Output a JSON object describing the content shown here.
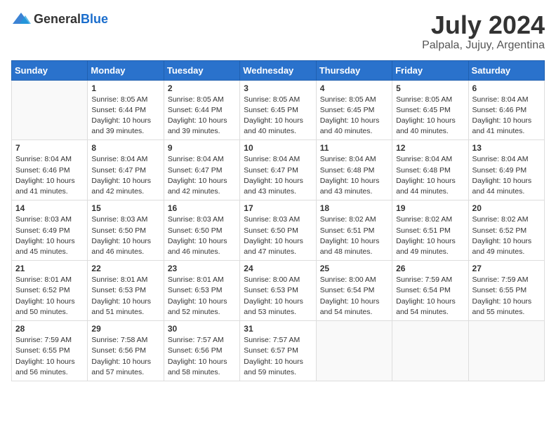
{
  "header": {
    "logo_general": "General",
    "logo_blue": "Blue",
    "month_year": "July 2024",
    "location": "Palpala, Jujuy, Argentina"
  },
  "weekdays": [
    "Sunday",
    "Monday",
    "Tuesday",
    "Wednesday",
    "Thursday",
    "Friday",
    "Saturday"
  ],
  "weeks": [
    [
      {
        "day": "",
        "sunrise": "",
        "sunset": "",
        "daylight": ""
      },
      {
        "day": "1",
        "sunrise": "Sunrise: 8:05 AM",
        "sunset": "Sunset: 6:44 PM",
        "daylight": "Daylight: 10 hours and 39 minutes."
      },
      {
        "day": "2",
        "sunrise": "Sunrise: 8:05 AM",
        "sunset": "Sunset: 6:44 PM",
        "daylight": "Daylight: 10 hours and 39 minutes."
      },
      {
        "day": "3",
        "sunrise": "Sunrise: 8:05 AM",
        "sunset": "Sunset: 6:45 PM",
        "daylight": "Daylight: 10 hours and 40 minutes."
      },
      {
        "day": "4",
        "sunrise": "Sunrise: 8:05 AM",
        "sunset": "Sunset: 6:45 PM",
        "daylight": "Daylight: 10 hours and 40 minutes."
      },
      {
        "day": "5",
        "sunrise": "Sunrise: 8:05 AM",
        "sunset": "Sunset: 6:45 PM",
        "daylight": "Daylight: 10 hours and 40 minutes."
      },
      {
        "day": "6",
        "sunrise": "Sunrise: 8:04 AM",
        "sunset": "Sunset: 6:46 PM",
        "daylight": "Daylight: 10 hours and 41 minutes."
      }
    ],
    [
      {
        "day": "7",
        "sunrise": "Sunrise: 8:04 AM",
        "sunset": "Sunset: 6:46 PM",
        "daylight": "Daylight: 10 hours and 41 minutes."
      },
      {
        "day": "8",
        "sunrise": "Sunrise: 8:04 AM",
        "sunset": "Sunset: 6:47 PM",
        "daylight": "Daylight: 10 hours and 42 minutes."
      },
      {
        "day": "9",
        "sunrise": "Sunrise: 8:04 AM",
        "sunset": "Sunset: 6:47 PM",
        "daylight": "Daylight: 10 hours and 42 minutes."
      },
      {
        "day": "10",
        "sunrise": "Sunrise: 8:04 AM",
        "sunset": "Sunset: 6:47 PM",
        "daylight": "Daylight: 10 hours and 43 minutes."
      },
      {
        "day": "11",
        "sunrise": "Sunrise: 8:04 AM",
        "sunset": "Sunset: 6:48 PM",
        "daylight": "Daylight: 10 hours and 43 minutes."
      },
      {
        "day": "12",
        "sunrise": "Sunrise: 8:04 AM",
        "sunset": "Sunset: 6:48 PM",
        "daylight": "Daylight: 10 hours and 44 minutes."
      },
      {
        "day": "13",
        "sunrise": "Sunrise: 8:04 AM",
        "sunset": "Sunset: 6:49 PM",
        "daylight": "Daylight: 10 hours and 44 minutes."
      }
    ],
    [
      {
        "day": "14",
        "sunrise": "Sunrise: 8:03 AM",
        "sunset": "Sunset: 6:49 PM",
        "daylight": "Daylight: 10 hours and 45 minutes."
      },
      {
        "day": "15",
        "sunrise": "Sunrise: 8:03 AM",
        "sunset": "Sunset: 6:50 PM",
        "daylight": "Daylight: 10 hours and 46 minutes."
      },
      {
        "day": "16",
        "sunrise": "Sunrise: 8:03 AM",
        "sunset": "Sunset: 6:50 PM",
        "daylight": "Daylight: 10 hours and 46 minutes."
      },
      {
        "day": "17",
        "sunrise": "Sunrise: 8:03 AM",
        "sunset": "Sunset: 6:50 PM",
        "daylight": "Daylight: 10 hours and 47 minutes."
      },
      {
        "day": "18",
        "sunrise": "Sunrise: 8:02 AM",
        "sunset": "Sunset: 6:51 PM",
        "daylight": "Daylight: 10 hours and 48 minutes."
      },
      {
        "day": "19",
        "sunrise": "Sunrise: 8:02 AM",
        "sunset": "Sunset: 6:51 PM",
        "daylight": "Daylight: 10 hours and 49 minutes."
      },
      {
        "day": "20",
        "sunrise": "Sunrise: 8:02 AM",
        "sunset": "Sunset: 6:52 PM",
        "daylight": "Daylight: 10 hours and 49 minutes."
      }
    ],
    [
      {
        "day": "21",
        "sunrise": "Sunrise: 8:01 AM",
        "sunset": "Sunset: 6:52 PM",
        "daylight": "Daylight: 10 hours and 50 minutes."
      },
      {
        "day": "22",
        "sunrise": "Sunrise: 8:01 AM",
        "sunset": "Sunset: 6:53 PM",
        "daylight": "Daylight: 10 hours and 51 minutes."
      },
      {
        "day": "23",
        "sunrise": "Sunrise: 8:01 AM",
        "sunset": "Sunset: 6:53 PM",
        "daylight": "Daylight: 10 hours and 52 minutes."
      },
      {
        "day": "24",
        "sunrise": "Sunrise: 8:00 AM",
        "sunset": "Sunset: 6:53 PM",
        "daylight": "Daylight: 10 hours and 53 minutes."
      },
      {
        "day": "25",
        "sunrise": "Sunrise: 8:00 AM",
        "sunset": "Sunset: 6:54 PM",
        "daylight": "Daylight: 10 hours and 54 minutes."
      },
      {
        "day": "26",
        "sunrise": "Sunrise: 7:59 AM",
        "sunset": "Sunset: 6:54 PM",
        "daylight": "Daylight: 10 hours and 54 minutes."
      },
      {
        "day": "27",
        "sunrise": "Sunrise: 7:59 AM",
        "sunset": "Sunset: 6:55 PM",
        "daylight": "Daylight: 10 hours and 55 minutes."
      }
    ],
    [
      {
        "day": "28",
        "sunrise": "Sunrise: 7:59 AM",
        "sunset": "Sunset: 6:55 PM",
        "daylight": "Daylight: 10 hours and 56 minutes."
      },
      {
        "day": "29",
        "sunrise": "Sunrise: 7:58 AM",
        "sunset": "Sunset: 6:56 PM",
        "daylight": "Daylight: 10 hours and 57 minutes."
      },
      {
        "day": "30",
        "sunrise": "Sunrise: 7:57 AM",
        "sunset": "Sunset: 6:56 PM",
        "daylight": "Daylight: 10 hours and 58 minutes."
      },
      {
        "day": "31",
        "sunrise": "Sunrise: 7:57 AM",
        "sunset": "Sunset: 6:57 PM",
        "daylight": "Daylight: 10 hours and 59 minutes."
      },
      {
        "day": "",
        "sunrise": "",
        "sunset": "",
        "daylight": ""
      },
      {
        "day": "",
        "sunrise": "",
        "sunset": "",
        "daylight": ""
      },
      {
        "day": "",
        "sunrise": "",
        "sunset": "",
        "daylight": ""
      }
    ]
  ]
}
